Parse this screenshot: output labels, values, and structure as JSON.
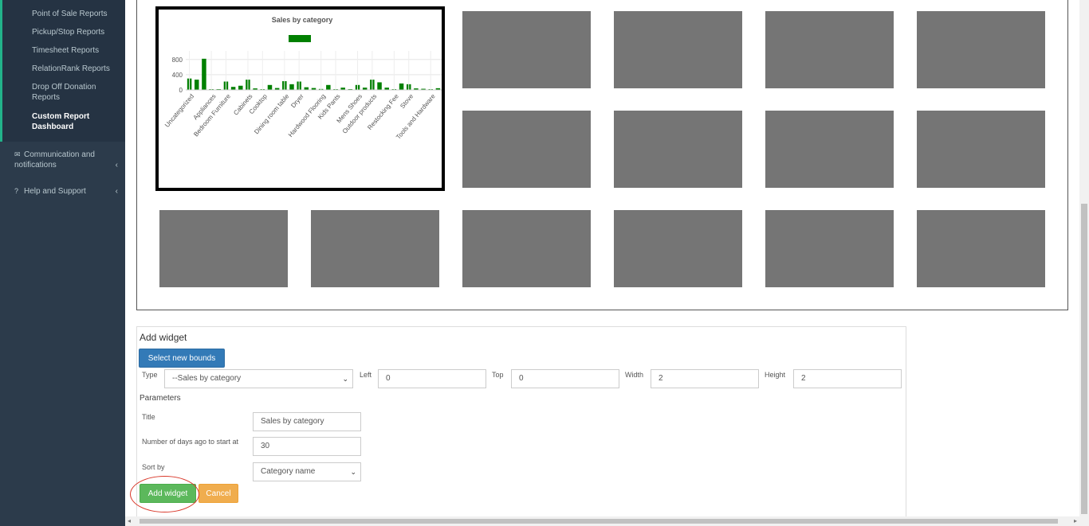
{
  "sidebar": {
    "sub_items": [
      {
        "label": "Point of Sale Reports"
      },
      {
        "label": "Pickup/Stop Reports"
      },
      {
        "label": "Timesheet Reports"
      },
      {
        "label": "RelationRank Reports"
      },
      {
        "label": "Drop Off Donation Reports"
      },
      {
        "label": "Custom Report Dashboard",
        "active": true
      }
    ],
    "menu": [
      {
        "label": "Communication and notifications",
        "icon": "envelope-icon"
      },
      {
        "label": "Help and Support",
        "icon": "question-circle-icon"
      }
    ]
  },
  "chart_data": {
    "type": "bar",
    "title": "Sales by category",
    "legend": "top",
    "color": "#008000",
    "categories": [
      "Uncategorized",
      "",
      "Appliances",
      "",
      "Bedroom Furniture",
      "",
      "Cabinets",
      "",
      "Cooktop",
      "",
      "Dining room table",
      "",
      "Dryer",
      "",
      "Hardwood Flooring",
      "",
      "Kids Pants",
      "",
      "Mens Shoes",
      "",
      "Outdoor products",
      "",
      "Restocking Fee",
      "",
      "Stove",
      "",
      "Tools and Hardware",
      ""
    ],
    "values": [
      300,
      270,
      820,
      10,
      5,
      220,
      80,
      110,
      270,
      40,
      5,
      130,
      50,
      230,
      150,
      220,
      70,
      50,
      25,
      130,
      20,
      60,
      5,
      130,
      60,
      270,
      200,
      60,
      5,
      170,
      150,
      40,
      30,
      5,
      45
    ],
    "yticks": [
      0,
      400,
      800
    ],
    "ylim": [
      0,
      900
    ],
    "grid": true
  },
  "form": {
    "title": "Add widget",
    "select_bounds_label": "Select new bounds",
    "type_label": "Type",
    "type_value": "--Sales by category",
    "left_label": "Left",
    "left_value": "0",
    "top_label": "Top",
    "top_value": "0",
    "width_label": "Width",
    "width_value": "2",
    "height_label": "Height",
    "height_value": "2",
    "parameters_label": "Parameters",
    "title_label": "Title",
    "title_value": "Sales by category",
    "days_label": "Number of days ago to start at",
    "days_value": "30",
    "sort_label": "Sort by",
    "sort_value": "Category name",
    "add_label": "Add widget",
    "cancel_label": "Cancel"
  }
}
